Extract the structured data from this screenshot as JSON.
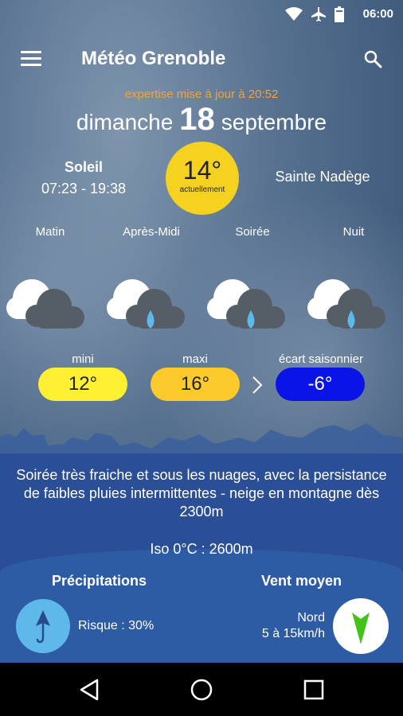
{
  "status": {
    "time": "06:00"
  },
  "app": {
    "title": "Météo Grenoble"
  },
  "header": {
    "updated": "expertise mise à jour à 20:52",
    "day_name": "dimanche",
    "day_number": "18",
    "month": "septembre"
  },
  "sun": {
    "label": "Soleil",
    "hours": "07:23 - 19:38"
  },
  "current": {
    "temp": "14°",
    "label": "actuellement"
  },
  "saint": "Sainte Nadège",
  "periods": [
    "Matin",
    "Après-Midi",
    "Soirée",
    "Nuit"
  ],
  "gauges": {
    "min": {
      "label": "mini",
      "value": "12°",
      "color": "#fff033"
    },
    "max": {
      "label": "maxi",
      "value": "16°",
      "color": "#fccb2b"
    },
    "gap": {
      "label": "écart saisonnier",
      "value": "-6°",
      "color": "#0a14e6"
    }
  },
  "description": "Soirée très fraiche et sous les nuages, avec la persistance de faibles pluies intermittentes - neige en montagne dès 2300m",
  "iso": "Iso 0°C : 2600m",
  "precipitation": {
    "title": "Précipitations",
    "risk": "Risque : 30%"
  },
  "wind": {
    "title": "Vent moyen",
    "direction": "Nord",
    "speed": "5 à 15km/h",
    "arrow_color": "#43c21a"
  },
  "icons": {
    "menu": "menu-icon",
    "search": "search-icon",
    "umbrella": "umbrella-icon",
    "wind_arrow": "wind-arrow-icon",
    "back": "back-icon",
    "home": "home-icon",
    "recents": "recents-icon"
  }
}
